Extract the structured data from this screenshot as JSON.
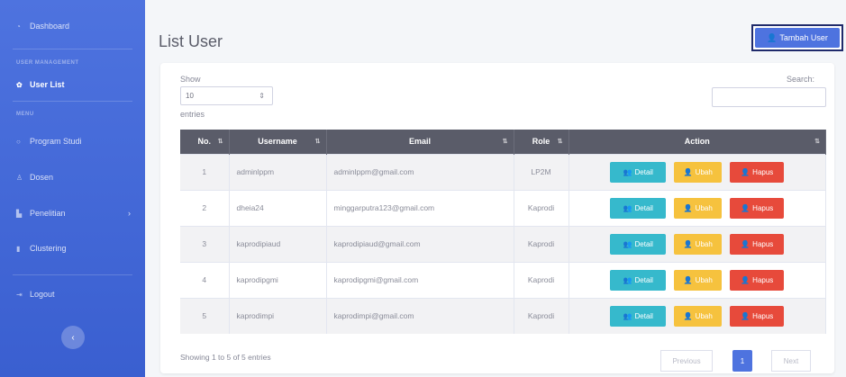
{
  "sidebar": {
    "dashboard": "Dashboard",
    "heading_user": "USER MANAGEMENT",
    "user_list": "User List",
    "heading_menu": "MENU",
    "program_studi": "Program Studi",
    "dosen": "Dosen",
    "penelitian": "Penelitian",
    "clustering": "Clustering",
    "logout": "Logout",
    "toggle": "‹"
  },
  "header": {
    "title": "List User",
    "add_button": "Tambah User"
  },
  "controls": {
    "show_label": "Show",
    "length_value": "10",
    "entries_label": "entries",
    "search_label": "Search:"
  },
  "table": {
    "columns": [
      "No.",
      "Username",
      "Email",
      "Role",
      "Action"
    ],
    "actions": {
      "detail": "Detail",
      "ubah": "Ubah",
      "hapus": "Hapus"
    },
    "rows": [
      {
        "no": "1",
        "username": "adminlppm",
        "email": "adminlppm@gmail.com",
        "role": "LP2M"
      },
      {
        "no": "2",
        "username": "dheia24",
        "email": "minggarputra123@gmail.com",
        "role": "Kaprodi"
      },
      {
        "no": "3",
        "username": "kaprodipiaud",
        "email": "kaprodipiaud@gmail.com",
        "role": "Kaprodi"
      },
      {
        "no": "4",
        "username": "kaprodipgmi",
        "email": "kaprodipgmi@gmail.com",
        "role": "Kaprodi"
      },
      {
        "no": "5",
        "username": "kaprodimpi",
        "email": "kaprodimpi@gmail.com",
        "role": "Kaprodi"
      }
    ]
  },
  "footer": {
    "info": "Showing 1 to 5 of 5 entries",
    "previous": "Previous",
    "page": "1",
    "next": "Next"
  },
  "colors": {
    "sidebar": "#4e73df",
    "table_header": "#5a5c69",
    "detail": "#36b9cc",
    "ubah": "#f6c23e",
    "hapus": "#e74a3b"
  }
}
